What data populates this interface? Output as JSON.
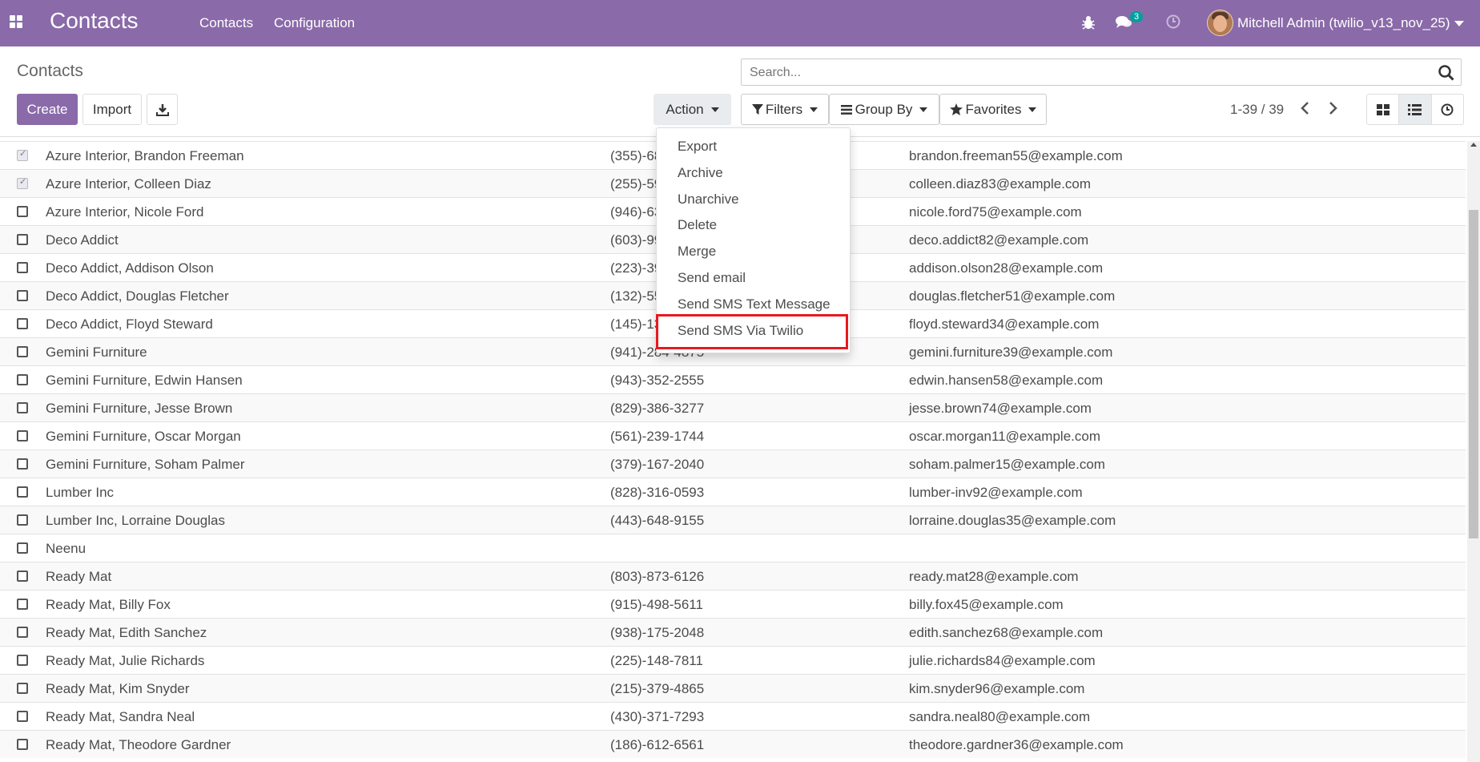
{
  "navbar": {
    "app_title": "Contacts",
    "menu": [
      "Contacts",
      "Configuration"
    ],
    "message_count": "3",
    "user_name": "Mitchell Admin (twilio_v13_nov_25)",
    "color": "#8a6aa9"
  },
  "control_panel": {
    "title": "Contacts",
    "search_placeholder": "Search...",
    "create_label": "Create",
    "import_label": "Import",
    "action_label": "Action",
    "filters_label": "Filters",
    "groupby_label": "Group By",
    "favorites_label": "Favorites",
    "pager": "1-39 / 39"
  },
  "action_menu": {
    "items": [
      "Export",
      "Archive",
      "Unarchive",
      "Delete",
      "Merge",
      "Send email",
      "Send SMS Text Message",
      "Send SMS Via Twilio"
    ],
    "highlighted": "Send SMS Via Twilio",
    "highlight_color": "#e8191f"
  },
  "rows": [
    {
      "name": "Azure Interior, Brandon Freeman",
      "phone": "(355)-68",
      "email": "brandon.freeman55@example.com",
      "checked": true
    },
    {
      "name": "Azure Interior, Colleen Diaz",
      "phone": "(255)-59",
      "email": "colleen.diaz83@example.com",
      "checked": true
    },
    {
      "name": "Azure Interior, Nicole Ford",
      "phone": "(946)-63",
      "email": "nicole.ford75@example.com",
      "checked": false
    },
    {
      "name": "Deco Addict",
      "phone": "(603)-99",
      "email": "deco.addict82@example.com",
      "checked": false
    },
    {
      "name": "Deco Addict, Addison Olson",
      "phone": "(223)-39",
      "email": "addison.olson28@example.com",
      "checked": false
    },
    {
      "name": "Deco Addict, Douglas Fletcher",
      "phone": "(132)-55",
      "email": "douglas.fletcher51@example.com",
      "checked": false
    },
    {
      "name": "Deco Addict, Floyd Steward",
      "phone": "(145)-13",
      "email": "floyd.steward34@example.com",
      "checked": false
    },
    {
      "name": "Gemini Furniture",
      "phone": "(941)-284-4875",
      "email": "gemini.furniture39@example.com",
      "checked": false
    },
    {
      "name": "Gemini Furniture, Edwin Hansen",
      "phone": "(943)-352-2555",
      "email": "edwin.hansen58@example.com",
      "checked": false
    },
    {
      "name": "Gemini Furniture, Jesse Brown",
      "phone": "(829)-386-3277",
      "email": "jesse.brown74@example.com",
      "checked": false
    },
    {
      "name": "Gemini Furniture, Oscar Morgan",
      "phone": "(561)-239-1744",
      "email": "oscar.morgan11@example.com",
      "checked": false
    },
    {
      "name": "Gemini Furniture, Soham Palmer",
      "phone": "(379)-167-2040",
      "email": "soham.palmer15@example.com",
      "checked": false
    },
    {
      "name": "Lumber Inc",
      "phone": "(828)-316-0593",
      "email": "lumber-inv92@example.com",
      "checked": false
    },
    {
      "name": "Lumber Inc, Lorraine Douglas",
      "phone": "(443)-648-9155",
      "email": "lorraine.douglas35@example.com",
      "checked": false
    },
    {
      "name": "Neenu",
      "phone": "",
      "email": "",
      "checked": false
    },
    {
      "name": "Ready Mat",
      "phone": "(803)-873-6126",
      "email": "ready.mat28@example.com",
      "checked": false
    },
    {
      "name": "Ready Mat, Billy Fox",
      "phone": "(915)-498-5611",
      "email": "billy.fox45@example.com",
      "checked": false
    },
    {
      "name": "Ready Mat, Edith Sanchez",
      "phone": "(938)-175-2048",
      "email": "edith.sanchez68@example.com",
      "checked": false
    },
    {
      "name": "Ready Mat, Julie Richards",
      "phone": "(225)-148-7811",
      "email": "julie.richards84@example.com",
      "checked": false
    },
    {
      "name": "Ready Mat, Kim Snyder",
      "phone": "(215)-379-4865",
      "email": "kim.snyder96@example.com",
      "checked": false
    },
    {
      "name": "Ready Mat, Sandra Neal",
      "phone": "(430)-371-7293",
      "email": "sandra.neal80@example.com",
      "checked": false
    },
    {
      "name": "Ready Mat, Theodore Gardner",
      "phone": "(186)-612-6561",
      "email": "theodore.gardner36@example.com",
      "checked": false
    }
  ]
}
